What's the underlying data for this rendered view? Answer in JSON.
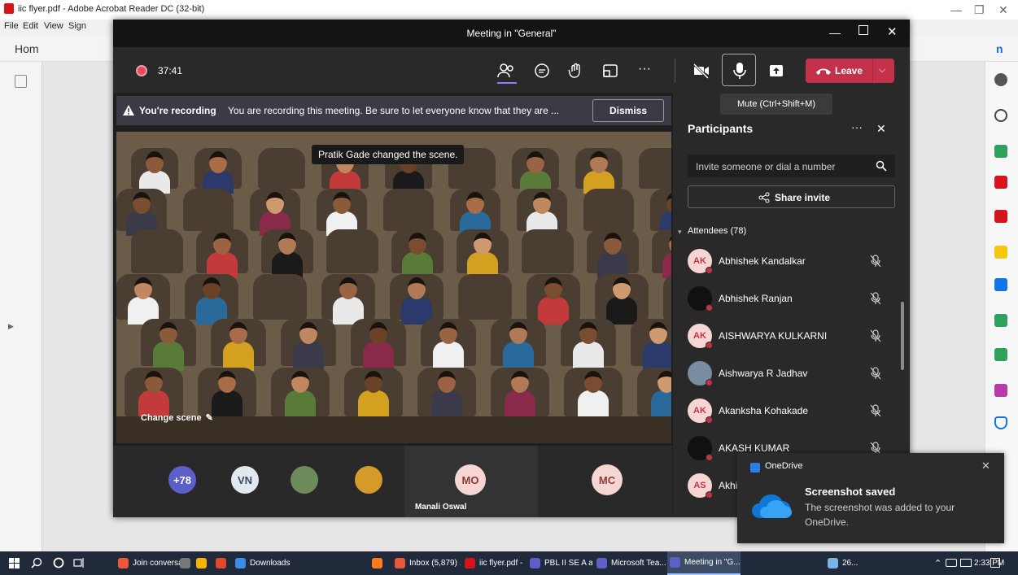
{
  "acrobat": {
    "title": "iic flyer.pdf - Adobe Acrobat Reader DC (32-bit)",
    "menu": [
      "File",
      "Edit",
      "View",
      "Sign"
    ],
    "home_tab": "Hom",
    "right_tab_fragment": "n"
  },
  "teams": {
    "window_title": "Meeting in \"General\"",
    "timer": "37:41",
    "leave_label": "Leave",
    "tooltip": "Mute (Ctrl+Shift+M)",
    "recording": {
      "bold": "You're recording",
      "message": "You are recording this meeting. Be sure to let everyone know that they are ...",
      "dismiss": "Dismiss"
    },
    "scene_toast": "Pratik Gade changed the scene.",
    "change_scene": "Change scene",
    "strip": [
      {
        "label": "+78",
        "color": "#5b5fc7",
        "text_color": "#ffffff"
      },
      {
        "label": "VN",
        "color": "#e1e8f0",
        "text_color": "#3a4a5a"
      },
      {
        "label": "",
        "color": "#6d8a5a",
        "text_color": "#ffffff"
      },
      {
        "label": "",
        "color": "#d69a2a",
        "text_color": "#ffffff"
      },
      {
        "label": "MO",
        "color": "#f6d6d3",
        "text_color": "#8a3a36",
        "name": "Manali Oswal"
      },
      {
        "label": "MC",
        "color": "#f6d6d3",
        "text_color": "#8a3a36"
      }
    ],
    "participants": {
      "title": "Participants",
      "invite_placeholder": "Invite someone or dial a number",
      "share_invite": "Share invite",
      "attendees_header": "Attendees (78)",
      "list": [
        {
          "initials": "AK",
          "name": "Abhishek Kandalkar",
          "avatar_color": "#f6d6d3",
          "initials_color": "#c4314b"
        },
        {
          "initials": "",
          "name": "Abhishek Ranjan",
          "avatar_color": "#111111",
          "initials_color": "#ffffff"
        },
        {
          "initials": "AK",
          "name": "AISHWARYA KULKARNI",
          "avatar_color": "#f6d6d3",
          "initials_color": "#c4314b"
        },
        {
          "initials": "",
          "name": "Aishwarya R Jadhav",
          "avatar_color": "#7a8ca0",
          "initials_color": "#ffffff"
        },
        {
          "initials": "AK",
          "name": "Akanksha Kohakade",
          "avatar_color": "#f6d6d3",
          "initials_color": "#c4314b"
        },
        {
          "initials": "",
          "name": "AKASH KUMAR",
          "avatar_color": "#111111",
          "initials_color": "#ffffff"
        },
        {
          "initials": "AS",
          "name": "Akhi",
          "avatar_color": "#f6d6d3",
          "initials_color": "#c4314b"
        }
      ]
    }
  },
  "onedrive_toast": {
    "app": "OneDrive",
    "title": "Screenshot saved",
    "body": "The screenshot was added to your OneDrive."
  },
  "taskbar": {
    "items": [
      {
        "label": "Join conversa...",
        "color": "#e8583a"
      },
      {
        "label": "",
        "color": "#777777"
      },
      {
        "label": "",
        "color": "#f4b400"
      },
      {
        "label": "",
        "color": "#e04a2a"
      },
      {
        "label": "Downloads",
        "color": "#3a8ee6"
      },
      {
        "label": "",
        "color": "#ff7a1a"
      },
      {
        "label": "Inbox (5,879) ...",
        "color": "#e8583a"
      },
      {
        "label": "iic flyer.pdf - ...",
        "color": "#d4161c"
      },
      {
        "label": "PBL II SE A an...",
        "color": "#5b5fc7"
      },
      {
        "label": "Microsoft Tea...",
        "color": "#5b5fc7"
      },
      {
        "label": "Meeting in \"G...",
        "color": "#5b5fc7"
      },
      {
        "label": "26...",
        "color": "#7ab4e6"
      }
    ],
    "time": "2:33 PM"
  },
  "colors": {
    "teams_purple": "#5b5fc7",
    "leave_red": "#c4314b",
    "panel_bg": "#292929"
  }
}
